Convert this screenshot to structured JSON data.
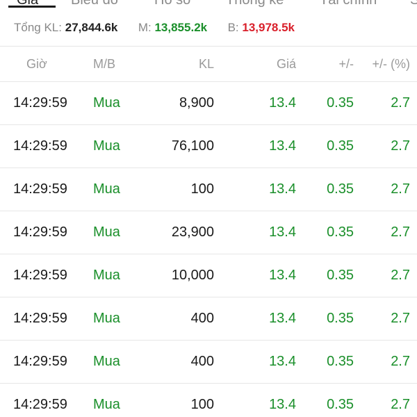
{
  "tabs": [
    {
      "label": "Giá",
      "active": true
    },
    {
      "label": "Biểu đồ",
      "active": false
    },
    {
      "label": "Hồ sơ",
      "active": false
    },
    {
      "label": "Thống kê",
      "active": false
    },
    {
      "label": "Tài chính",
      "active": false
    },
    {
      "label": "S",
      "active": false
    }
  ],
  "summary": {
    "total_label": "Tổng KL:",
    "total_value": "27,844.6k",
    "buy_label": "M:",
    "buy_value": "13,855.2k",
    "sell_label": "B:",
    "sell_value": "13,978.5k"
  },
  "columns": [
    "Giờ",
    "M/B",
    "KL",
    "Giá",
    "+/-",
    "+/- (%)"
  ],
  "rows": [
    {
      "time": "14:29:59",
      "side": "Mua",
      "volume": "8,900",
      "price": "13.4",
      "change": "0.35",
      "change_pct": "2.7"
    },
    {
      "time": "14:29:59",
      "side": "Mua",
      "volume": "76,100",
      "price": "13.4",
      "change": "0.35",
      "change_pct": "2.7"
    },
    {
      "time": "14:29:59",
      "side": "Mua",
      "volume": "100",
      "price": "13.4",
      "change": "0.35",
      "change_pct": "2.7"
    },
    {
      "time": "14:29:59",
      "side": "Mua",
      "volume": "23,900",
      "price": "13.4",
      "change": "0.35",
      "change_pct": "2.7"
    },
    {
      "time": "14:29:59",
      "side": "Mua",
      "volume": "10,000",
      "price": "13.4",
      "change": "0.35",
      "change_pct": "2.7"
    },
    {
      "time": "14:29:59",
      "side": "Mua",
      "volume": "400",
      "price": "13.4",
      "change": "0.35",
      "change_pct": "2.7"
    },
    {
      "time": "14:29:59",
      "side": "Mua",
      "volume": "400",
      "price": "13.4",
      "change": "0.35",
      "change_pct": "2.7"
    },
    {
      "time": "14:29:59",
      "side": "Mua",
      "volume": "100",
      "price": "13.4",
      "change": "0.35",
      "change_pct": "2.7"
    }
  ],
  "colors": {
    "buy": "#1a8f2a",
    "sell": "#d9202b",
    "muted": "#8a8a8a",
    "text": "#1a1a1a"
  }
}
